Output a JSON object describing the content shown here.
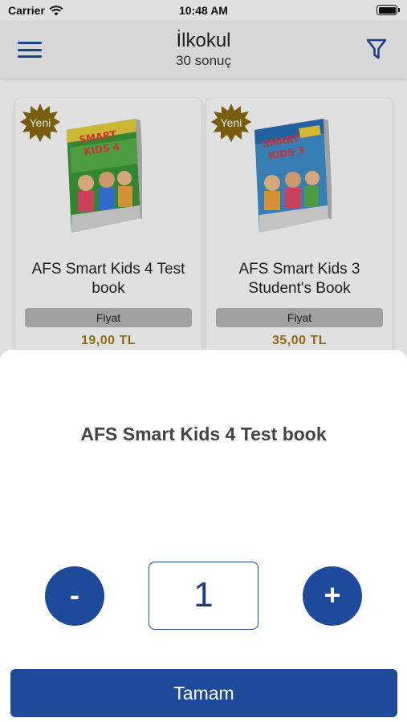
{
  "status_bar": {
    "carrier": "Carrier",
    "time": "10:48 AM"
  },
  "header": {
    "title": "İlkokul",
    "subtitle": "30 sonuç"
  },
  "products": [
    {
      "badge": "Yeni",
      "name": "AFS Smart Kids 4 Test book",
      "price_label": "Fiyat",
      "price": "19,00  TL"
    },
    {
      "badge": "Yeni",
      "name": "AFS Smart Kids 3 Student's Book",
      "price_label": "Fiyat",
      "price": "35,00  TL"
    }
  ],
  "sheet": {
    "title": "AFS Smart Kids 4 Test book",
    "minus_label": "-",
    "plus_label": "+",
    "quantity": "1",
    "ok_label": "Tamam"
  },
  "colors": {
    "accent": "#1e4a9c",
    "price": "#a3791a",
    "badge": "#8a6a10"
  }
}
